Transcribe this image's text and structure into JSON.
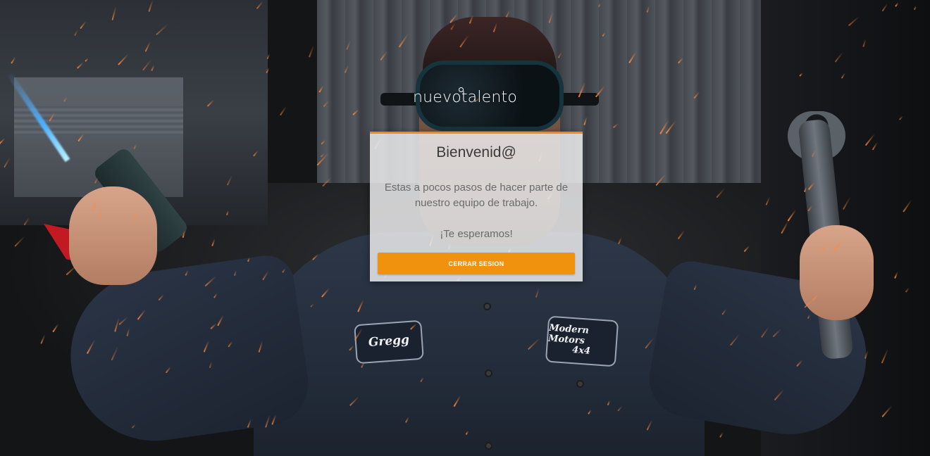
{
  "brand": {
    "logo_text": "nuevotalento",
    "accent_color": "#f0920e"
  },
  "welcome_card": {
    "title": "Bienvenid@",
    "message": "Estas a pocos pasos de hacer parte de nuestro equipo de trabajo.",
    "subtitle": "¡Te esperamos!",
    "logout_button_label": "CERRAR SESION"
  },
  "background": {
    "name_patch": "Gregg",
    "company_patch_line1": "Modern Motors",
    "company_patch_line2": "4x4"
  }
}
